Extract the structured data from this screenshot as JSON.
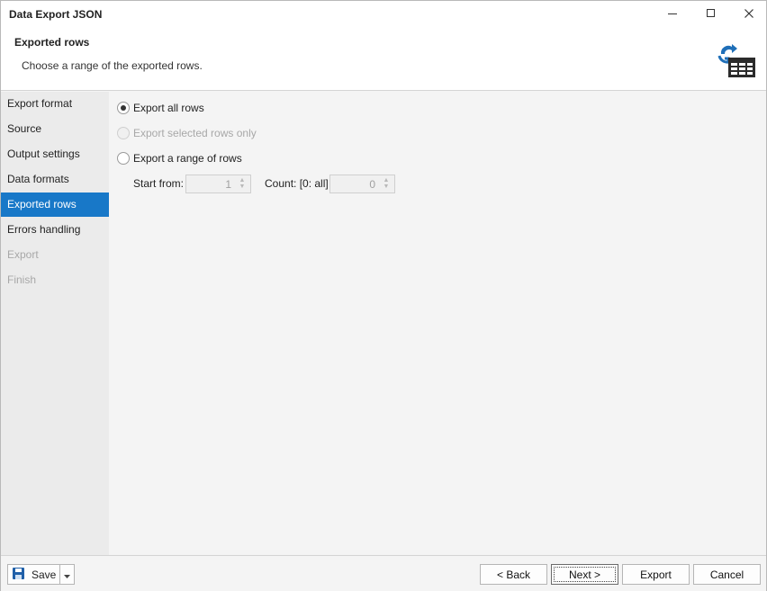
{
  "window": {
    "title": "Data Export JSON",
    "controls": {
      "minimize": "minimize-icon",
      "maximize": "maximize-icon",
      "close": "close-icon"
    }
  },
  "header": {
    "title": "Exported rows",
    "subtitle": "Choose a range of the exported rows.",
    "icon": "export-table-icon",
    "icon_color": "#1f6fb8"
  },
  "sidebar": {
    "items": [
      {
        "label": "Export format",
        "state": "normal"
      },
      {
        "label": "Source",
        "state": "normal"
      },
      {
        "label": "Output settings",
        "state": "normal"
      },
      {
        "label": "Data formats",
        "state": "normal"
      },
      {
        "label": "Exported rows",
        "state": "active"
      },
      {
        "label": "Errors handling",
        "state": "normal"
      },
      {
        "label": "Export",
        "state": "disabled"
      },
      {
        "label": "Finish",
        "state": "disabled"
      }
    ],
    "active_color": "#1878c8"
  },
  "options": {
    "all_rows": {
      "label": "Export all rows",
      "checked": true
    },
    "selected_rows": {
      "label": "Export selected rows only",
      "checked": false,
      "enabled": false
    },
    "range_rows": {
      "label": "Export a range of rows",
      "checked": false
    }
  },
  "range": {
    "start_label": "Start from:",
    "start_value": "1",
    "count_label": "Count: [0: all]",
    "count_value": "0"
  },
  "footer": {
    "save_label": "Save",
    "back_label": "< Back",
    "next_label": "Next >",
    "export_label": "Export",
    "cancel_label": "Cancel"
  }
}
